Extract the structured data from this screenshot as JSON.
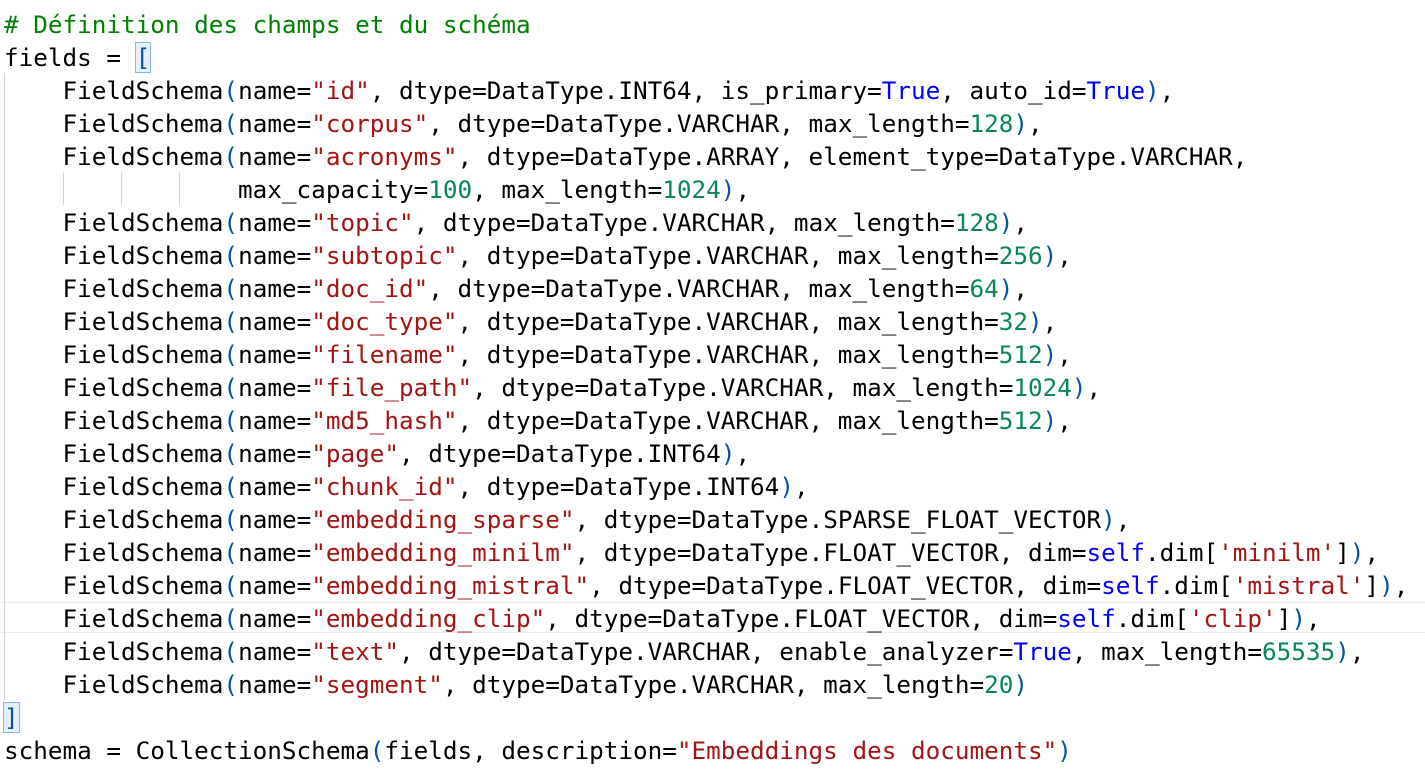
{
  "code": {
    "lines": [
      [
        {
          "t": "# Définition des champs et du schéma",
          "c": "c"
        }
      ],
      [
        {
          "t": "fields = ",
          "c": "k"
        },
        {
          "t": "[",
          "c": "p",
          "match": true
        }
      ],
      [
        {
          "t": "    FieldSchema",
          "c": "k"
        },
        {
          "t": "(",
          "c": "p"
        },
        {
          "t": "name=",
          "c": "k"
        },
        {
          "t": "\"id\"",
          "c": "s"
        },
        {
          "t": ", dtype=DataType.INT64, is_primary=",
          "c": "k"
        },
        {
          "t": "True",
          "c": "b"
        },
        {
          "t": ", auto_id=",
          "c": "k"
        },
        {
          "t": "True",
          "c": "b"
        },
        {
          "t": ")",
          "c": "p"
        },
        {
          "t": ",",
          "c": "k"
        }
      ],
      [
        {
          "t": "    FieldSchema",
          "c": "k"
        },
        {
          "t": "(",
          "c": "p"
        },
        {
          "t": "name=",
          "c": "k"
        },
        {
          "t": "\"corpus\"",
          "c": "s"
        },
        {
          "t": ", dtype=DataType.VARCHAR, max_length=",
          "c": "k"
        },
        {
          "t": "128",
          "c": "n"
        },
        {
          "t": ")",
          "c": "p"
        },
        {
          "t": ",",
          "c": "k"
        }
      ],
      [
        {
          "t": "    FieldSchema",
          "c": "k"
        },
        {
          "t": "(",
          "c": "p"
        },
        {
          "t": "name=",
          "c": "k"
        },
        {
          "t": "\"acronyms\"",
          "c": "s"
        },
        {
          "t": ", dtype=DataType.ARRAY, element_type=DataType.VARCHAR,",
          "c": "k"
        }
      ],
      [
        {
          "t": "                max_capacity=",
          "c": "k"
        },
        {
          "t": "100",
          "c": "n"
        },
        {
          "t": ", max_length=",
          "c": "k"
        },
        {
          "t": "1024",
          "c": "n"
        },
        {
          "t": ")",
          "c": "p"
        },
        {
          "t": ",",
          "c": "k"
        }
      ],
      [
        {
          "t": "    FieldSchema",
          "c": "k"
        },
        {
          "t": "(",
          "c": "p"
        },
        {
          "t": "name=",
          "c": "k"
        },
        {
          "t": "\"topic\"",
          "c": "s"
        },
        {
          "t": ", dtype=DataType.VARCHAR, max_length=",
          "c": "k"
        },
        {
          "t": "128",
          "c": "n"
        },
        {
          "t": ")",
          "c": "p"
        },
        {
          "t": ",",
          "c": "k"
        }
      ],
      [
        {
          "t": "    FieldSchema",
          "c": "k"
        },
        {
          "t": "(",
          "c": "p"
        },
        {
          "t": "name=",
          "c": "k"
        },
        {
          "t": "\"subtopic\"",
          "c": "s"
        },
        {
          "t": ", dtype=DataType.VARCHAR, max_length=",
          "c": "k"
        },
        {
          "t": "256",
          "c": "n"
        },
        {
          "t": ")",
          "c": "p"
        },
        {
          "t": ",",
          "c": "k"
        }
      ],
      [
        {
          "t": "    FieldSchema",
          "c": "k"
        },
        {
          "t": "(",
          "c": "p"
        },
        {
          "t": "name=",
          "c": "k"
        },
        {
          "t": "\"doc_id\"",
          "c": "s"
        },
        {
          "t": ", dtype=DataType.VARCHAR, max_length=",
          "c": "k"
        },
        {
          "t": "64",
          "c": "n"
        },
        {
          "t": ")",
          "c": "p"
        },
        {
          "t": ",",
          "c": "k"
        }
      ],
      [
        {
          "t": "    FieldSchema",
          "c": "k"
        },
        {
          "t": "(",
          "c": "p"
        },
        {
          "t": "name=",
          "c": "k"
        },
        {
          "t": "\"doc_type\"",
          "c": "s"
        },
        {
          "t": ", dtype=DataType.VARCHAR, max_length=",
          "c": "k"
        },
        {
          "t": "32",
          "c": "n"
        },
        {
          "t": ")",
          "c": "p"
        },
        {
          "t": ",",
          "c": "k"
        }
      ],
      [
        {
          "t": "    FieldSchema",
          "c": "k"
        },
        {
          "t": "(",
          "c": "p"
        },
        {
          "t": "name=",
          "c": "k"
        },
        {
          "t": "\"filename\"",
          "c": "s"
        },
        {
          "t": ", dtype=DataType.VARCHAR, max_length=",
          "c": "k"
        },
        {
          "t": "512",
          "c": "n"
        },
        {
          "t": ")",
          "c": "p"
        },
        {
          "t": ",",
          "c": "k"
        }
      ],
      [
        {
          "t": "    FieldSchema",
          "c": "k"
        },
        {
          "t": "(",
          "c": "p"
        },
        {
          "t": "name=",
          "c": "k"
        },
        {
          "t": "\"file_path\"",
          "c": "s"
        },
        {
          "t": ", dtype=DataType.VARCHAR, max_length=",
          "c": "k"
        },
        {
          "t": "1024",
          "c": "n"
        },
        {
          "t": ")",
          "c": "p"
        },
        {
          "t": ",",
          "c": "k"
        }
      ],
      [
        {
          "t": "    FieldSchema",
          "c": "k"
        },
        {
          "t": "(",
          "c": "p"
        },
        {
          "t": "name=",
          "c": "k"
        },
        {
          "t": "\"md5_hash\"",
          "c": "s"
        },
        {
          "t": ", dtype=DataType.VARCHAR, max_length=",
          "c": "k"
        },
        {
          "t": "512",
          "c": "n"
        },
        {
          "t": ")",
          "c": "p"
        },
        {
          "t": ",",
          "c": "k"
        }
      ],
      [
        {
          "t": "    FieldSchema",
          "c": "k"
        },
        {
          "t": "(",
          "c": "p"
        },
        {
          "t": "name=",
          "c": "k"
        },
        {
          "t": "\"page\"",
          "c": "s"
        },
        {
          "t": ", dtype=DataType.INT64",
          "c": "k"
        },
        {
          "t": ")",
          "c": "p"
        },
        {
          "t": ",",
          "c": "k"
        }
      ],
      [
        {
          "t": "    FieldSchema",
          "c": "k"
        },
        {
          "t": "(",
          "c": "p"
        },
        {
          "t": "name=",
          "c": "k"
        },
        {
          "t": "\"chunk_id\"",
          "c": "s"
        },
        {
          "t": ", dtype=DataType.INT64",
          "c": "k"
        },
        {
          "t": ")",
          "c": "p"
        },
        {
          "t": ",",
          "c": "k"
        }
      ],
      [
        {
          "t": "    FieldSchema",
          "c": "k"
        },
        {
          "t": "(",
          "c": "p"
        },
        {
          "t": "name=",
          "c": "k"
        },
        {
          "t": "\"embedding_sparse\"",
          "c": "s"
        },
        {
          "t": ", dtype=DataType.SPARSE_FLOAT_VECTOR",
          "c": "k"
        },
        {
          "t": ")",
          "c": "p"
        },
        {
          "t": ",",
          "c": "k"
        }
      ],
      [
        {
          "t": "    FieldSchema",
          "c": "k"
        },
        {
          "t": "(",
          "c": "p"
        },
        {
          "t": "name=",
          "c": "k"
        },
        {
          "t": "\"embedding_minilm\"",
          "c": "s"
        },
        {
          "t": ", dtype=DataType.FLOAT_VECTOR, dim=",
          "c": "k"
        },
        {
          "t": "self",
          "c": "b"
        },
        {
          "t": ".dim[",
          "c": "k"
        },
        {
          "t": "'minilm'",
          "c": "s"
        },
        {
          "t": "]",
          "c": "k"
        },
        {
          "t": ")",
          "c": "p"
        },
        {
          "t": ",",
          "c": "k"
        }
      ],
      [
        {
          "t": "    FieldSchema",
          "c": "k"
        },
        {
          "t": "(",
          "c": "p"
        },
        {
          "t": "name=",
          "c": "k"
        },
        {
          "t": "\"embedding_mistral\"",
          "c": "s"
        },
        {
          "t": ", dtype=DataType.FLOAT_VECTOR, dim=",
          "c": "k"
        },
        {
          "t": "self",
          "c": "b"
        },
        {
          "t": ".dim[",
          "c": "k"
        },
        {
          "t": "'mistral'",
          "c": "s"
        },
        {
          "t": "]",
          "c": "k"
        },
        {
          "t": ")",
          "c": "p"
        },
        {
          "t": ",",
          "c": "k"
        }
      ],
      [
        {
          "t": "    FieldSchema",
          "c": "k"
        },
        {
          "t": "(",
          "c": "p"
        },
        {
          "t": "name=",
          "c": "k"
        },
        {
          "t": "\"embedding_clip\"",
          "c": "s"
        },
        {
          "t": ", dtype=DataType.FLOAT_VECTOR, dim=",
          "c": "k"
        },
        {
          "t": "self",
          "c": "b"
        },
        {
          "t": ".dim[",
          "c": "k"
        },
        {
          "t": "'clip'",
          "c": "s"
        },
        {
          "t": "]",
          "c": "k"
        },
        {
          "t": ")",
          "c": "p"
        },
        {
          "t": ",",
          "c": "k"
        }
      ],
      [
        {
          "t": "    FieldSchema",
          "c": "k"
        },
        {
          "t": "(",
          "c": "p"
        },
        {
          "t": "name=",
          "c": "k"
        },
        {
          "t": "\"text\"",
          "c": "s"
        },
        {
          "t": ", dtype=DataType.VARCHAR, enable_analyzer=",
          "c": "k"
        },
        {
          "t": "True",
          "c": "b"
        },
        {
          "t": ", max_length=",
          "c": "k"
        },
        {
          "t": "65535",
          "c": "n"
        },
        {
          "t": ")",
          "c": "p"
        },
        {
          "t": ",",
          "c": "k"
        }
      ],
      [
        {
          "t": "    FieldSchema",
          "c": "k"
        },
        {
          "t": "(",
          "c": "p"
        },
        {
          "t": "name=",
          "c": "k"
        },
        {
          "t": "\"segment\"",
          "c": "s"
        },
        {
          "t": ", dtype=DataType.VARCHAR, max_length=",
          "c": "k"
        },
        {
          "t": "20",
          "c": "n"
        },
        {
          "t": ")",
          "c": "p"
        }
      ],
      [
        {
          "t": "]",
          "c": "p",
          "match": true
        }
      ],
      [
        {
          "t": "schema = CollectionSchema",
          "c": "k"
        },
        {
          "t": "(",
          "c": "p"
        },
        {
          "t": "fields, description=",
          "c": "k"
        },
        {
          "t": "\"Embeddings des documents\"",
          "c": "s"
        },
        {
          "t": ")",
          "c": "p"
        }
      ]
    ]
  }
}
